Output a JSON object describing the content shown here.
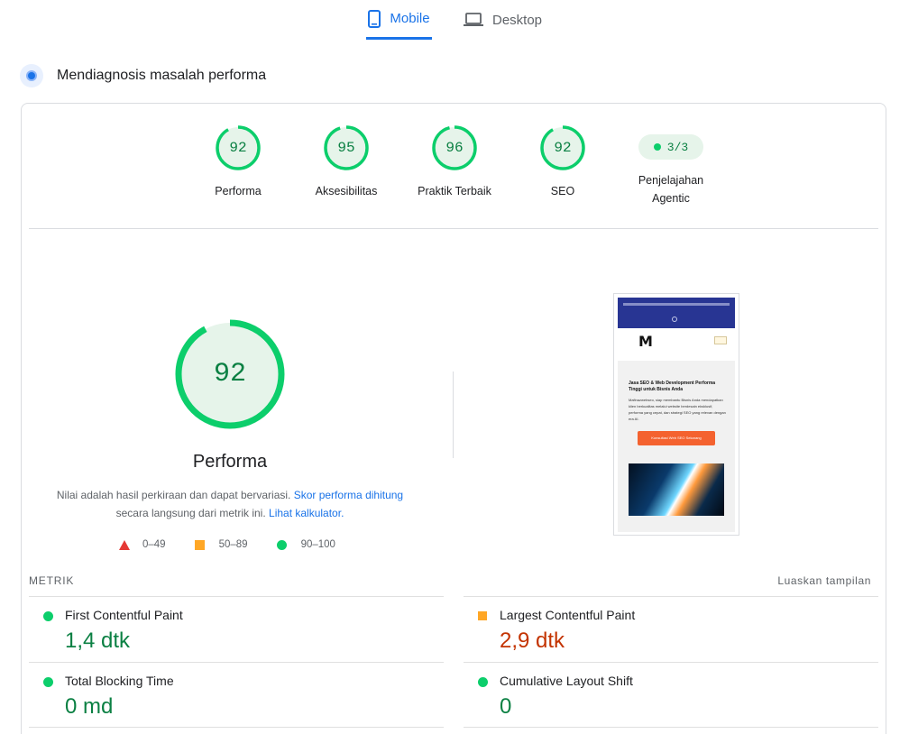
{
  "tabs": [
    {
      "label": "Mobile",
      "icon": "smartphone-icon",
      "active": true
    },
    {
      "label": "Desktop",
      "icon": "laptop-icon",
      "active": false
    }
  ],
  "diagnose": {
    "title": "Mendiagnosis masalah performa",
    "icon": "lighthouse-icon"
  },
  "scores": [
    {
      "label": "Performa",
      "value": "92"
    },
    {
      "label": "Aksesibilitas",
      "value": "95"
    },
    {
      "label": "Praktik Terbaik",
      "value": "96"
    },
    {
      "label": "SEO",
      "value": "92"
    }
  ],
  "agentic": {
    "value": "3/3",
    "label_line1": "Penjelajahan",
    "label_line2": "Agentic"
  },
  "performance": {
    "score": "92",
    "score_fraction": 0.92,
    "title": "Performa",
    "note_text1": "Nilai adalah hasil perkiraan dan dapat bervariasi. ",
    "note_link1": "Skor performa dihitung",
    "note_text2": "secara langsung dari metrik ini. ",
    "note_link2": "Lihat kalkulator."
  },
  "legend": [
    {
      "range": "0–49",
      "shape": "triangle",
      "color": "#e53935"
    },
    {
      "range": "50–89",
      "shape": "square",
      "color": "#ffa726"
    },
    {
      "range": "90–100",
      "shape": "circle",
      "color": "#0cce6b"
    }
  ],
  "preview": {
    "heading": "Jasa SEO & Web Development Performa Tinggi untuk Bisnis Anda",
    "paragraph": "Mafinazwebseo, siap membantu Bisnis Anda mendapatkan klien berkualitas melalui website berdesain eksklusif, performa yang cepat, dan strategi SEO yang relevan dengan era AI.",
    "button": "Konsultasi Web SEO Sekarang"
  },
  "metrics_header": {
    "title": "METRIK",
    "expand": "Luaskan tampilan"
  },
  "metrics_left": [
    {
      "name": "First Contentful Paint",
      "value": "1,4 dtk",
      "status": "good"
    },
    {
      "name": "Total Blocking Time",
      "value": "0 md",
      "status": "good"
    }
  ],
  "metrics_right": [
    {
      "name": "Largest Contentful Paint",
      "value": "2,9 dtk",
      "status": "average"
    },
    {
      "name": "Cumulative Layout Shift",
      "value": "0",
      "status": "good"
    }
  ],
  "colors": {
    "accent": "#1a73e8",
    "good": "#0cce6b",
    "good_text": "#0b8043",
    "average": "#ffa726",
    "poor": "#e53935"
  }
}
